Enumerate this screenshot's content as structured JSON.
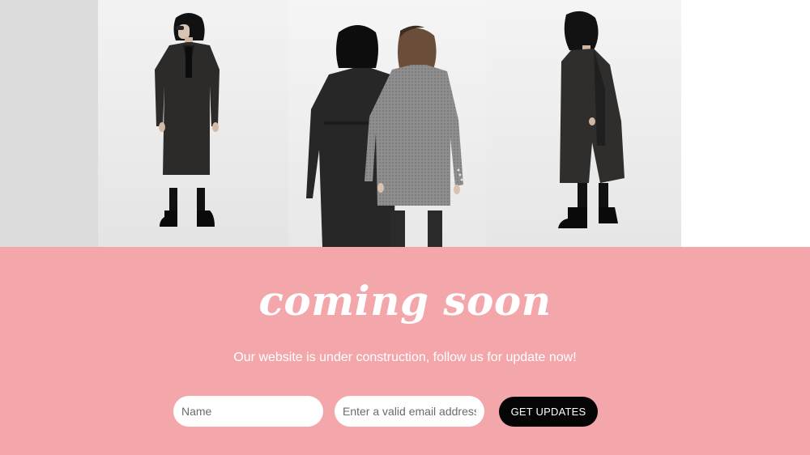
{
  "hero": {
    "headline": "coming soon",
    "subtitle": "Our website is under construction, follow us for update now!",
    "background_color": "#f4a7aa"
  },
  "signup_form": {
    "name_placeholder": "Name",
    "name_value": "",
    "email_placeholder": "Enter a valid email address",
    "email_value": "",
    "submit_label": "GET UPDATES"
  },
  "gallery": {
    "photos": [
      {
        "subject": "model-front-dark-trench-coat"
      },
      {
        "subject": "two-models-back-view-coats"
      },
      {
        "subject": "model-side-view-dark-trench-coat"
      }
    ]
  }
}
